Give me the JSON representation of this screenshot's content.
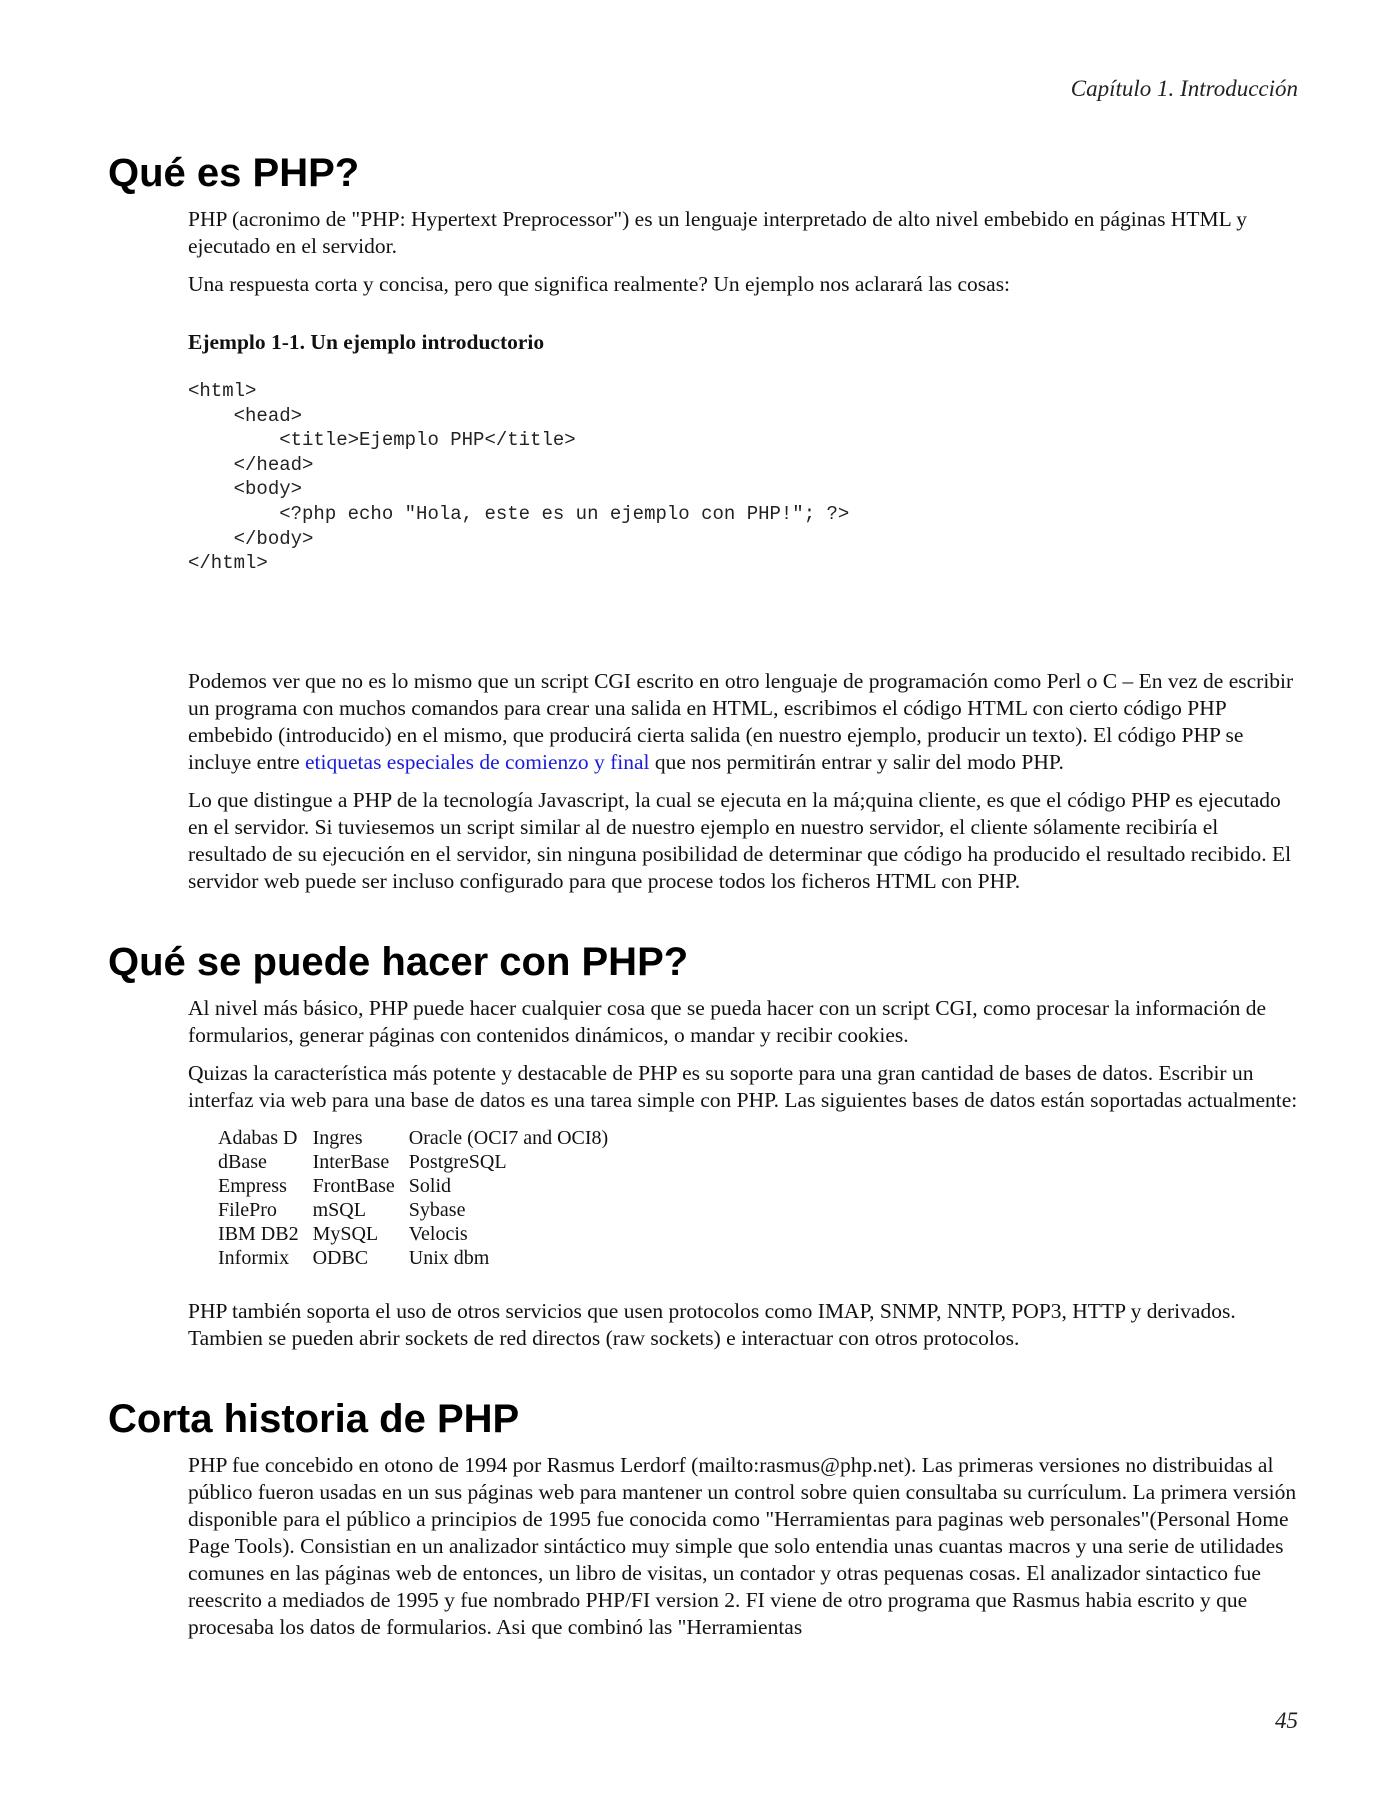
{
  "header": {
    "chapter": "Capítulo 1. Introducción"
  },
  "footer": {
    "page_number": "45"
  },
  "section1": {
    "title": "Qué es PHP?",
    "p1": "PHP (acronimo de \"PHP: Hypertext Preprocessor\") es un lenguaje interpretado de alto nivel embebido en páginas HTML y ejecutado en el servidor.",
    "p2": "Una respuesta corta y concisa, pero que significa realmente? Un ejemplo nos aclarará las cosas:",
    "example_title": "Ejemplo 1-1. Un ejemplo introductorio",
    "code": "<html>\n    <head>\n        <title>Ejemplo PHP</title>\n    </head>\n    <body>\n        <?php echo \"Hola, este es un ejemplo con PHP!\"; ?>\n    </body>\n</html>",
    "p3_before": "Podemos ver que no es lo mismo que un script CGI escrito en otro lenguaje de programación como Perl o C – En vez de escribir un programa con muchos comandos para crear una salida en HTML, escribimos el código HTML con cierto código PHP embebido (introducido) en el mismo, que producirá cierta salida (en nuestro ejemplo, producir un texto). El código PHP se incluye entre ",
    "p3_link": "etiquetas especiales de comienzo y final",
    "p3_after": " que nos permitirán entrar y salir del modo PHP.",
    "p4": "Lo que distingue a PHP de la tecnología Javascript, la cual se ejecuta en la má;quina cliente, es que el código PHP es ejecutado en el servidor. Si tuviesemos un script similar al de nuestro ejemplo en nuestro servidor, el cliente sólamente recibiría el resultado de su ejecución en el servidor, sin ninguna posibilidad de determinar que código ha producido el resultado recibido. El servidor web puede ser incluso configurado para que procese todos los ficheros HTML con PHP."
  },
  "section2": {
    "title": "Qué se puede hacer con PHP?",
    "p1": "Al nivel más básico, PHP puede hacer cualquier cosa que se pueda hacer con un script CGI, como procesar la información de formularios, generar páginas con contenidos dinámicos, o mandar y recibir cookies.",
    "p2": "Quizas la característica más potente y destacable de PHP es su soporte para una gran cantidad de bases de datos. Escribir un interfaz via web para una base de datos es una tarea simple con PHP. Las siguientes bases de datos están soportadas actualmente:",
    "databases": [
      [
        "Adabas D",
        "Ingres",
        "Oracle (OCI7 and OCI8)"
      ],
      [
        "dBase",
        "InterBase",
        "PostgreSQL"
      ],
      [
        "Empress",
        "FrontBase",
        "Solid"
      ],
      [
        "FilePro",
        "mSQL",
        "Sybase"
      ],
      [
        "IBM DB2",
        "MySQL",
        "Velocis"
      ],
      [
        "Informix",
        "ODBC",
        "Unix dbm"
      ]
    ],
    "p3": "PHP también soporta el uso de otros servicios que usen protocolos como IMAP, SNMP, NNTP, POP3, HTTP y derivados. Tambien se pueden abrir sockets de red directos (raw sockets) e interactuar con otros protocolos."
  },
  "section3": {
    "title": "Corta historia de PHP",
    "p1": "PHP fue concebido en otono de 1994 por Rasmus Lerdorf (mailto:rasmus@php.net). Las primeras versiones no distribuidas al público fueron usadas en un sus páginas web para mantener un control sobre quien consultaba su currículum. La primera versión disponible para el público a principios de 1995 fue conocida como \"Herramientas para paginas web personales\"(Personal Home Page Tools). Consistian en un analizador sintáctico muy simple que solo entendia unas cuantas macros y una serie de utilidades comunes en las páginas web de entonces, un libro de visitas, un contador y otras pequenas cosas. El analizador sintactico fue reescrito a mediados de 1995 y fue nombrado PHP/FI version 2. FI viene de otro programa que Rasmus habia escrito y que procesaba los datos de formularios. Asi que combinó las \"Herramientas"
  }
}
